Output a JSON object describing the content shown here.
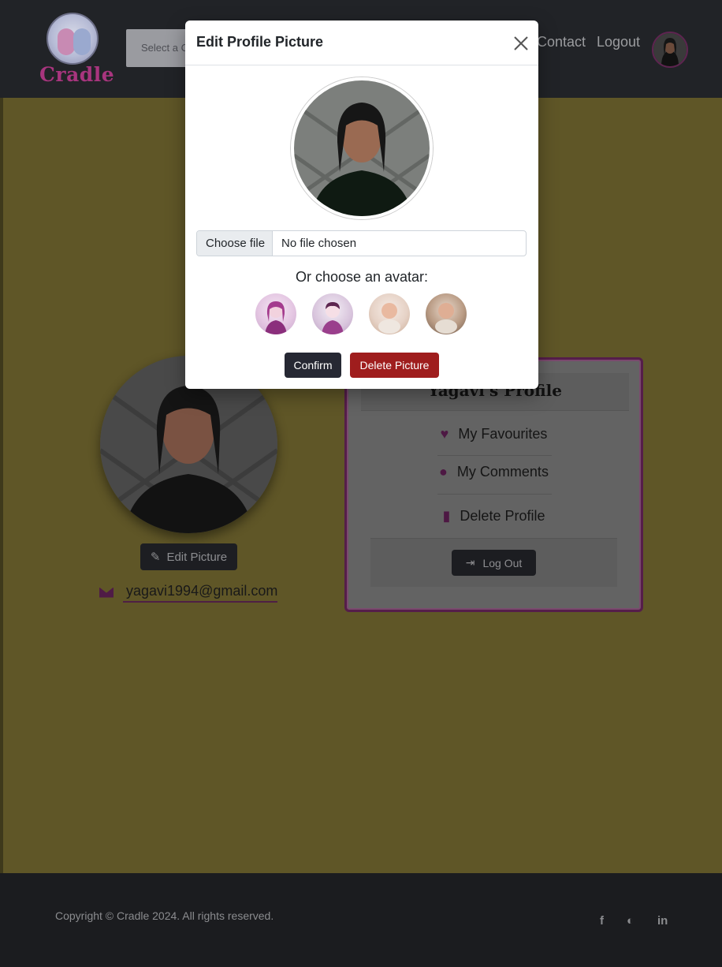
{
  "app": {
    "name": "Cradle"
  },
  "navbar": {
    "logo_text": "Cradle",
    "category_select_placeholder": "Select a C",
    "links": {
      "contact": "Contact",
      "logout": "Logout"
    },
    "avatar_icon": "user-avatar"
  },
  "profile": {
    "edit_picture_label": "Edit Picture",
    "email": "yagavi1994@gmail.com",
    "card": {
      "title": "Yagavi's Profile",
      "items": [
        {
          "label": "My Favourites",
          "icon": "heart-icon"
        },
        {
          "label": "My Comments",
          "icon": "comment-icon"
        },
        {
          "label": "Delete Profile",
          "icon": "trash-icon"
        }
      ],
      "logout_label": "Log Out"
    }
  },
  "modal": {
    "title": "Edit Profile Picture",
    "file_button": "Choose file",
    "file_status": "No file chosen",
    "avatar_heading": "Or choose an avatar:",
    "avatars": [
      "avatar-woman",
      "avatar-man",
      "avatar-baby-1",
      "avatar-baby-2"
    ],
    "confirm_label": "Confirm",
    "delete_label": "Delete Picture"
  },
  "footer": {
    "copyright": "Copyright © Cradle 2024. All rights reserved.",
    "social": [
      "facebook-icon",
      "github-icon",
      "linkedin-icon"
    ]
  },
  "colors": {
    "brand": "#a8357e",
    "accent_dark": "#262833",
    "danger": "#9f1d1d",
    "page_bg": "#bfae50"
  }
}
